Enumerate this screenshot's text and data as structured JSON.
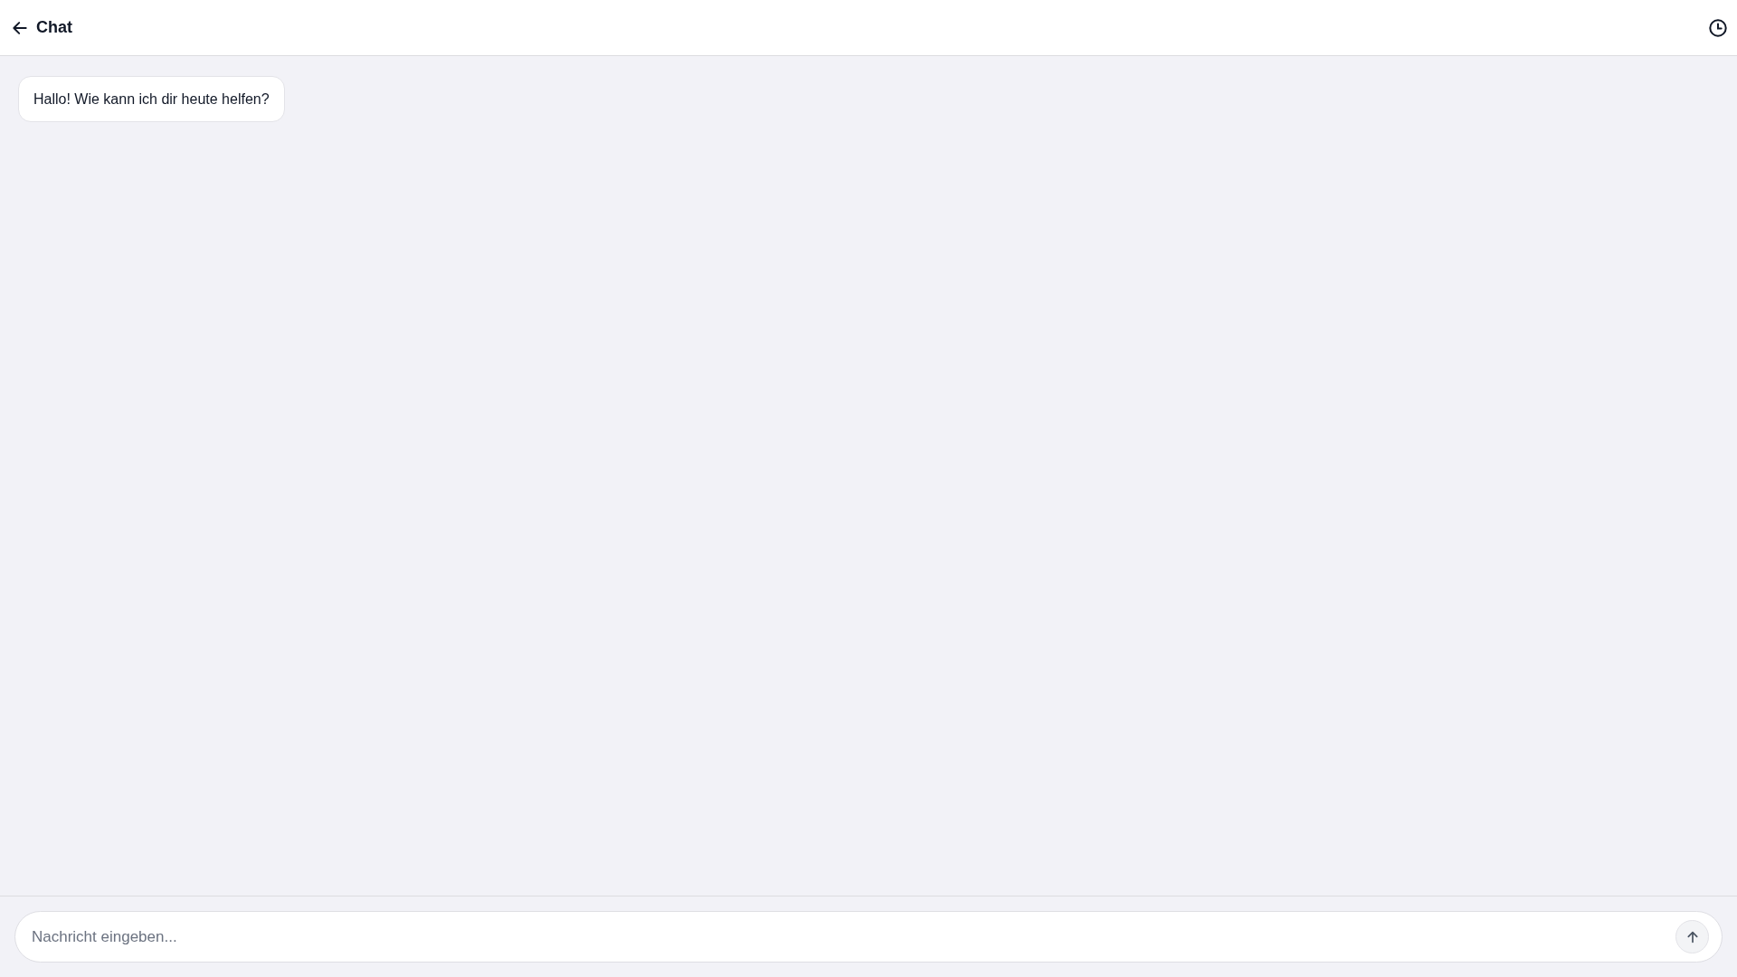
{
  "header": {
    "title": "Chat"
  },
  "messages": [
    {
      "kind": "incoming",
      "text": "Hallo! Wie kann ich dir heute helfen?"
    }
  ],
  "composer": {
    "placeholder": "Nachricht eingeben..."
  }
}
